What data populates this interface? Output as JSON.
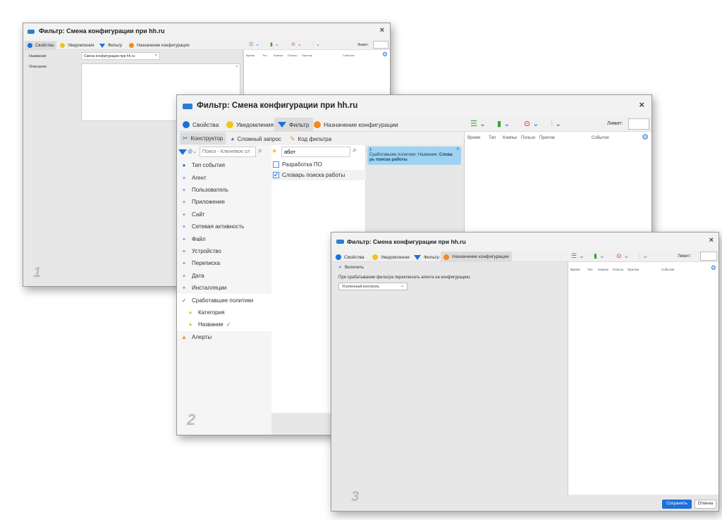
{
  "w1": {
    "title": "Фильтр: Смена конфигурации при hh.ru",
    "close": "×",
    "tabs": [
      "Свойства",
      "Уведомления",
      "Фильтр",
      "Назначение конфигурации"
    ],
    "limit_label": "Лимит:",
    "fields": {
      "name_label": "Название",
      "name_value": "Смена конфигурации при hh.ru",
      "desc_label": "Описание"
    },
    "columns": [
      "Время",
      "Тип",
      "Компьк",
      "Пользо",
      "Прилож",
      "Событие"
    ],
    "watermark": "1"
  },
  "w2": {
    "title": "Фильтр: Смена конфигурации при hh.ru",
    "close": "×",
    "tabs": [
      "Свойства",
      "Уведомления",
      "Фильтр",
      "Назначение конфигурации"
    ],
    "limit_label": "Лимит:",
    "subtabs": [
      "Конструктор",
      "Сложный запрос",
      "Код фильтра"
    ],
    "search_placeholder": "Поиск - Ключевое сл",
    "search2_value": "абот",
    "tree": [
      {
        "label": "Тип события",
        "kind": "bullet"
      },
      {
        "label": "Агент",
        "kind": "plus"
      },
      {
        "label": "Пользователь",
        "kind": "plus"
      },
      {
        "label": "Приложение",
        "kind": "plus"
      },
      {
        "label": "Сайт",
        "kind": "plus"
      },
      {
        "label": "Сетевая активность",
        "kind": "plus"
      },
      {
        "label": "Файл",
        "kind": "plus"
      },
      {
        "label": "Устройство",
        "kind": "plus"
      },
      {
        "label": "Переписка",
        "kind": "plus"
      },
      {
        "label": "Дата",
        "kind": "plus"
      },
      {
        "label": "Инсталляции",
        "kind": "plus"
      },
      {
        "label": "Сработавшие политики",
        "kind": "check"
      },
      {
        "label": "Категория",
        "kind": "bulb"
      },
      {
        "label": "Название",
        "kind": "bulb-check"
      },
      {
        "label": "Алерты",
        "kind": "bell"
      }
    ],
    "values": [
      {
        "label": "Разработка ПО",
        "checked": false
      },
      {
        "label": "Словарь поиска работы",
        "checked": true
      }
    ],
    "condition": {
      "index": "1",
      "prefix": "Сработавшие политики: Название:",
      "value_a": "Слова",
      "value_b": "рь поиска работы"
    },
    "columns": [
      "Время",
      "Тип",
      "Компьк",
      "Пользо",
      "Прилож",
      "Событие"
    ],
    "watermark": "2"
  },
  "w3": {
    "title": "Фильтр: Смена конфигурации при hh.ru",
    "close": "×",
    "tabs": [
      "Свойства",
      "Уведомления",
      "Фильтр",
      "Назначение конфигурации"
    ],
    "limit_label": "Лимит:",
    "enable_label": "Включить",
    "enable_checked": true,
    "switch_label": "При срабатывании фильтра переключать агента на конфигурацию:",
    "config_value": "Усиленный контроль",
    "columns": [
      "Время",
      "Тип",
      "Компьк",
      "Пользо",
      "Прилож",
      "Событие"
    ],
    "save": "Сохранить",
    "cancel": "Отмена",
    "watermark": "3"
  },
  "colors": {
    "accent": "#1e6fd9",
    "orange": "#f28a1e",
    "red": "#d9262c",
    "green": "#3aa335",
    "yellow": "#f0c419",
    "condition_bg": "#9fd2f2"
  }
}
